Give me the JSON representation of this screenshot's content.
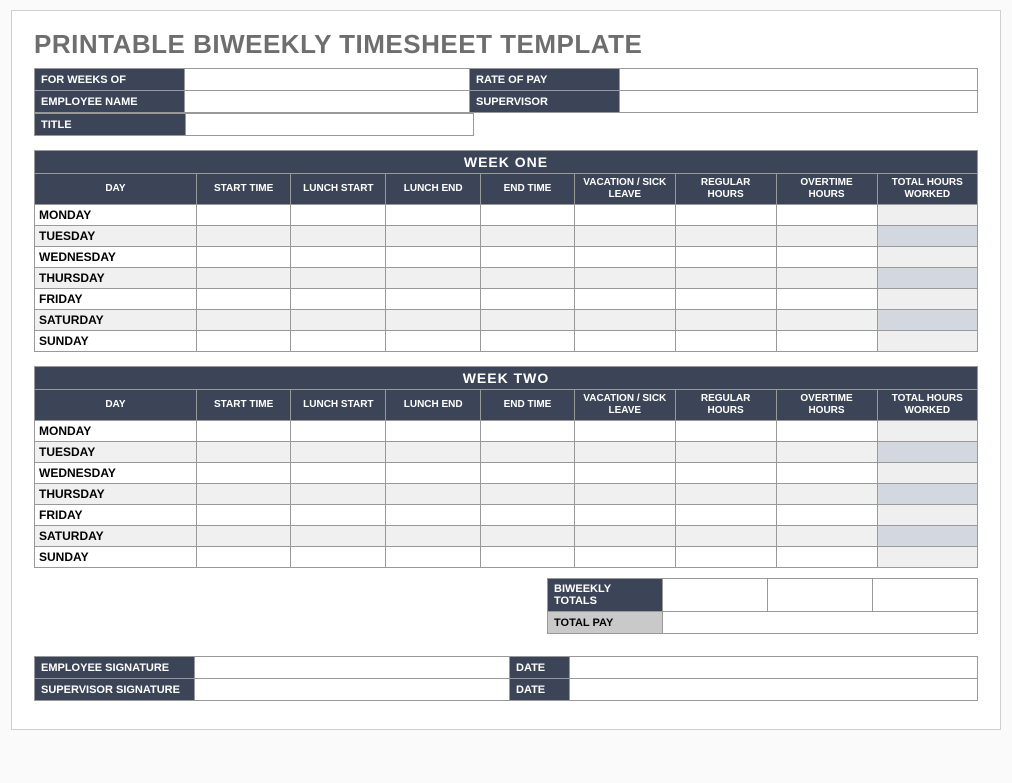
{
  "title": "PRINTABLE BIWEEKLY TIMESHEET TEMPLATE",
  "header": {
    "for_weeks_of_label": "FOR WEEKS OF",
    "for_weeks_of_value": "",
    "rate_of_pay_label": "RATE OF PAY",
    "rate_of_pay_value": "",
    "employee_name_label": "EMPLOYEE NAME",
    "employee_name_value": "",
    "supervisor_label": "SUPERVISOR",
    "supervisor_value": "",
    "title_label": "TITLE",
    "title_value": ""
  },
  "columns": {
    "day": "DAY",
    "start_time": "START TIME",
    "lunch_start": "LUNCH START",
    "lunch_end": "LUNCH END",
    "end_time": "END TIME",
    "vacation_sick": "VACATION / SICK LEAVE",
    "regular_hours": "REGULAR HOURS",
    "overtime_hours": "OVERTIME HOURS",
    "total_hours": "TOTAL HOURS WORKED"
  },
  "weeks": [
    {
      "title": "WEEK ONE",
      "days": [
        {
          "name": "MONDAY",
          "start": "",
          "lunch_start": "",
          "lunch_end": "",
          "end": "",
          "vac": "",
          "reg": "",
          "ot": "",
          "tot": ""
        },
        {
          "name": "TUESDAY",
          "start": "",
          "lunch_start": "",
          "lunch_end": "",
          "end": "",
          "vac": "",
          "reg": "",
          "ot": "",
          "tot": ""
        },
        {
          "name": "WEDNESDAY",
          "start": "",
          "lunch_start": "",
          "lunch_end": "",
          "end": "",
          "vac": "",
          "reg": "",
          "ot": "",
          "tot": ""
        },
        {
          "name": "THURSDAY",
          "start": "",
          "lunch_start": "",
          "lunch_end": "",
          "end": "",
          "vac": "",
          "reg": "",
          "ot": "",
          "tot": ""
        },
        {
          "name": "FRIDAY",
          "start": "",
          "lunch_start": "",
          "lunch_end": "",
          "end": "",
          "vac": "",
          "reg": "",
          "ot": "",
          "tot": ""
        },
        {
          "name": "SATURDAY",
          "start": "",
          "lunch_start": "",
          "lunch_end": "",
          "end": "",
          "vac": "",
          "reg": "",
          "ot": "",
          "tot": ""
        },
        {
          "name": "SUNDAY",
          "start": "",
          "lunch_start": "",
          "lunch_end": "",
          "end": "",
          "vac": "",
          "reg": "",
          "ot": "",
          "tot": ""
        }
      ]
    },
    {
      "title": "WEEK TWO",
      "days": [
        {
          "name": "MONDAY",
          "start": "",
          "lunch_start": "",
          "lunch_end": "",
          "end": "",
          "vac": "",
          "reg": "",
          "ot": "",
          "tot": ""
        },
        {
          "name": "TUESDAY",
          "start": "",
          "lunch_start": "",
          "lunch_end": "",
          "end": "",
          "vac": "",
          "reg": "",
          "ot": "",
          "tot": ""
        },
        {
          "name": "WEDNESDAY",
          "start": "",
          "lunch_start": "",
          "lunch_end": "",
          "end": "",
          "vac": "",
          "reg": "",
          "ot": "",
          "tot": ""
        },
        {
          "name": "THURSDAY",
          "start": "",
          "lunch_start": "",
          "lunch_end": "",
          "end": "",
          "vac": "",
          "reg": "",
          "ot": "",
          "tot": ""
        },
        {
          "name": "FRIDAY",
          "start": "",
          "lunch_start": "",
          "lunch_end": "",
          "end": "",
          "vac": "",
          "reg": "",
          "ot": "",
          "tot": ""
        },
        {
          "name": "SATURDAY",
          "start": "",
          "lunch_start": "",
          "lunch_end": "",
          "end": "",
          "vac": "",
          "reg": "",
          "ot": "",
          "tot": ""
        },
        {
          "name": "SUNDAY",
          "start": "",
          "lunch_start": "",
          "lunch_end": "",
          "end": "",
          "vac": "",
          "reg": "",
          "ot": "",
          "tot": ""
        }
      ]
    }
  ],
  "totals": {
    "biweekly_totals_label": "BIWEEKLY TOTALS",
    "biweekly_reg": "",
    "biweekly_ot": "",
    "biweekly_tot": "",
    "total_pay_label": "TOTAL PAY",
    "total_pay_value": ""
  },
  "signatures": {
    "employee_sig_label": "EMPLOYEE SIGNATURE",
    "employee_sig_value": "",
    "employee_date_label": "DATE",
    "employee_date_value": "",
    "supervisor_sig_label": "SUPERVISOR SIGNATURE",
    "supervisor_sig_value": "",
    "supervisor_date_label": "DATE",
    "supervisor_date_value": ""
  }
}
